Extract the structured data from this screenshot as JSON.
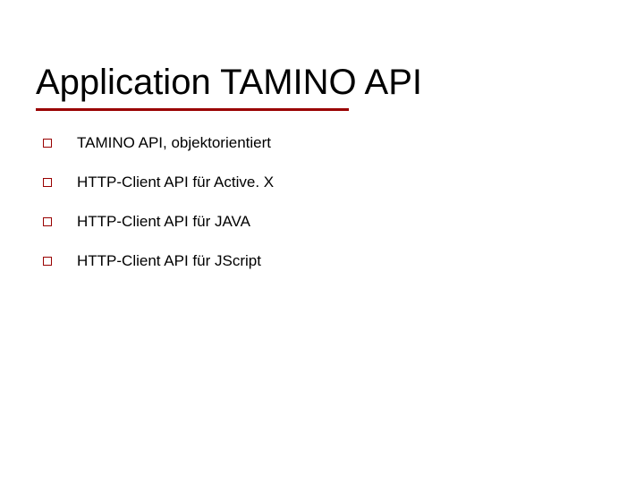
{
  "title": "Application TAMINO API",
  "bullets": [
    {
      "text": "TAMINO API, objektorientiert"
    },
    {
      "text": "HTTP-Client API für Active. X"
    },
    {
      "text": "HTTP-Client API für JAVA"
    },
    {
      "text": "HTTP-Client API für JScript"
    }
  ],
  "accent_color": "#990000"
}
